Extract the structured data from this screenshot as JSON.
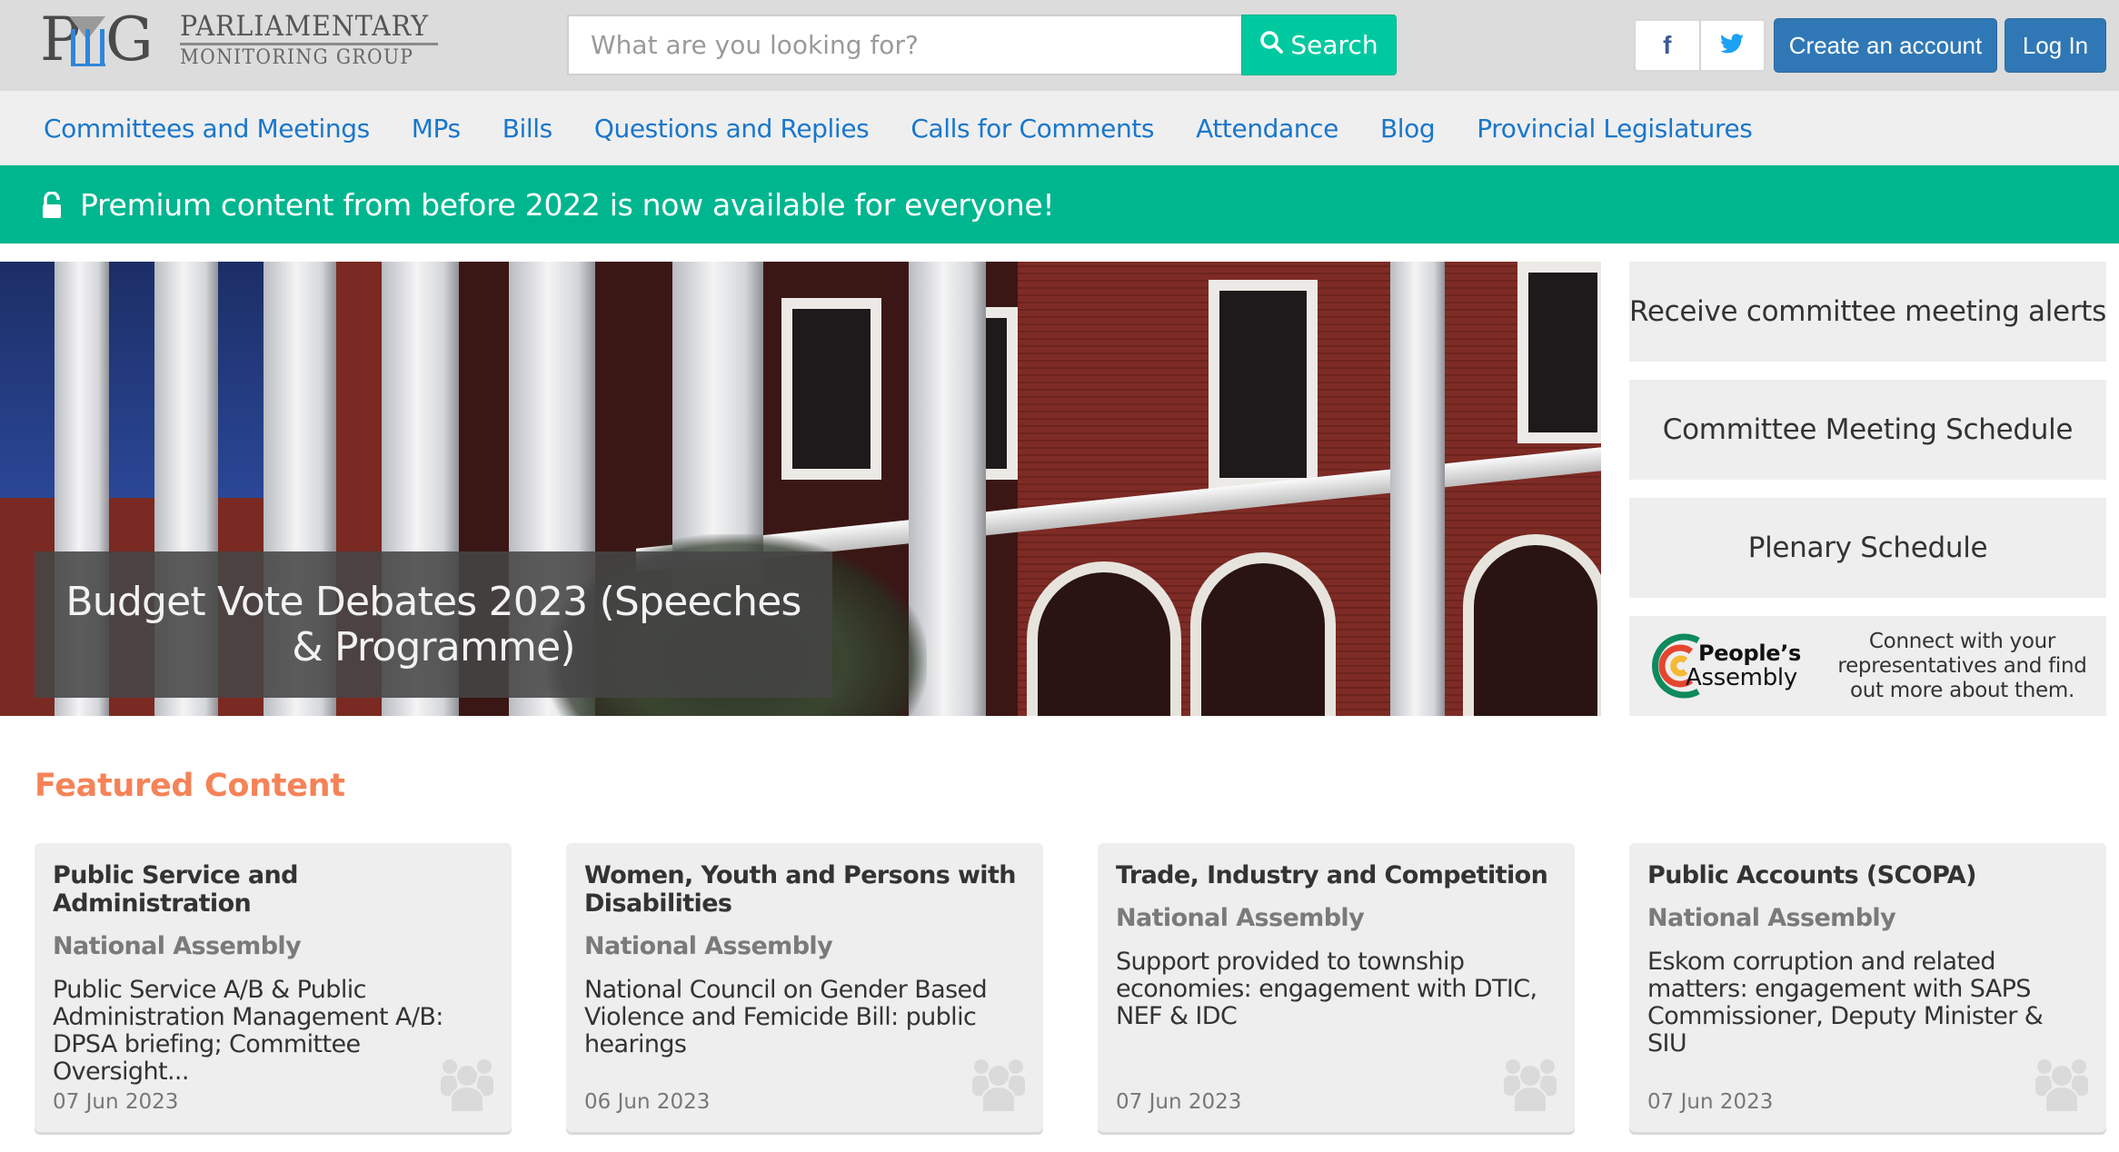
{
  "header": {
    "logo": {
      "mark": "PMG",
      "line1": "PARLIAMENTARY",
      "line2": "MONITORING GROUP"
    },
    "search": {
      "placeholder": "What are you looking for?",
      "value": "",
      "button_label": "Search",
      "button_icon": "search-icon"
    },
    "social": [
      {
        "name": "facebook",
        "icon": "facebook-icon",
        "glyph": "f",
        "color": "#3b5998"
      },
      {
        "name": "twitter",
        "icon": "twitter-icon",
        "color": "#1da1f2"
      }
    ],
    "create_account_label": "Create an account",
    "login_label": "Log In"
  },
  "nav": {
    "items": [
      {
        "label": "Committees and Meetings"
      },
      {
        "label": "MPs"
      },
      {
        "label": "Bills"
      },
      {
        "label": "Questions and Replies"
      },
      {
        "label": "Calls for Comments"
      },
      {
        "label": "Attendance"
      },
      {
        "label": "Blog"
      },
      {
        "label": "Provincial Legislatures"
      }
    ]
  },
  "promo_banner": {
    "icon": "unlock-icon",
    "text": "Premium content from before 2022 is now available for everyone!"
  },
  "hero": {
    "caption": "Budget Vote Debates 2023 (Speeches & Programme)"
  },
  "side_links": [
    {
      "label": "Receive committee meeting alerts"
    },
    {
      "label": "Committee Meeting Schedule"
    },
    {
      "label": "Plenary Schedule"
    }
  ],
  "peoples_assembly": {
    "name_bold": "People’s",
    "name_regular": "Assembly",
    "text": "Connect with your representatives and find out more about them."
  },
  "featured": {
    "title": "Featured Content",
    "cards": [
      {
        "committee": "Public Service and Administration",
        "house": "National Assembly",
        "description": "Public Service A/B & Public Administration Management A/B: DPSA briefing; Committee Oversight...",
        "date": "07 Jun 2023",
        "icon": "people-icon"
      },
      {
        "committee": "Women, Youth and Persons with Disabilities",
        "house": "National Assembly",
        "description": "National Council on Gender Based Violence and Femicide Bill: public hearings",
        "date": "06 Jun 2023",
        "icon": "people-icon"
      },
      {
        "committee": "Trade, Industry and Competition",
        "house": "National Assembly",
        "description": "Support provided to township economies: engagement with DTIC, NEF & IDC",
        "date": "07 Jun 2023",
        "icon": "people-icon"
      },
      {
        "committee": "Public Accounts (SCOPA)",
        "house": "National Assembly",
        "description": "Eskom corruption and related matters: engagement with SAPS Commissioner, Deputy Minister & SIU",
        "date": "07 Jun 2023",
        "icon": "people-icon"
      }
    ]
  },
  "colors": {
    "header_bg": "#dcdcdc",
    "nav_bg": "#efefef",
    "nav_link": "#1877cc",
    "promo_bg": "#00b68f",
    "search_button": "#00c9a0",
    "primary_button": "#2f78b5",
    "featured_title": "#f58357",
    "card_bg": "#eeeeee"
  }
}
